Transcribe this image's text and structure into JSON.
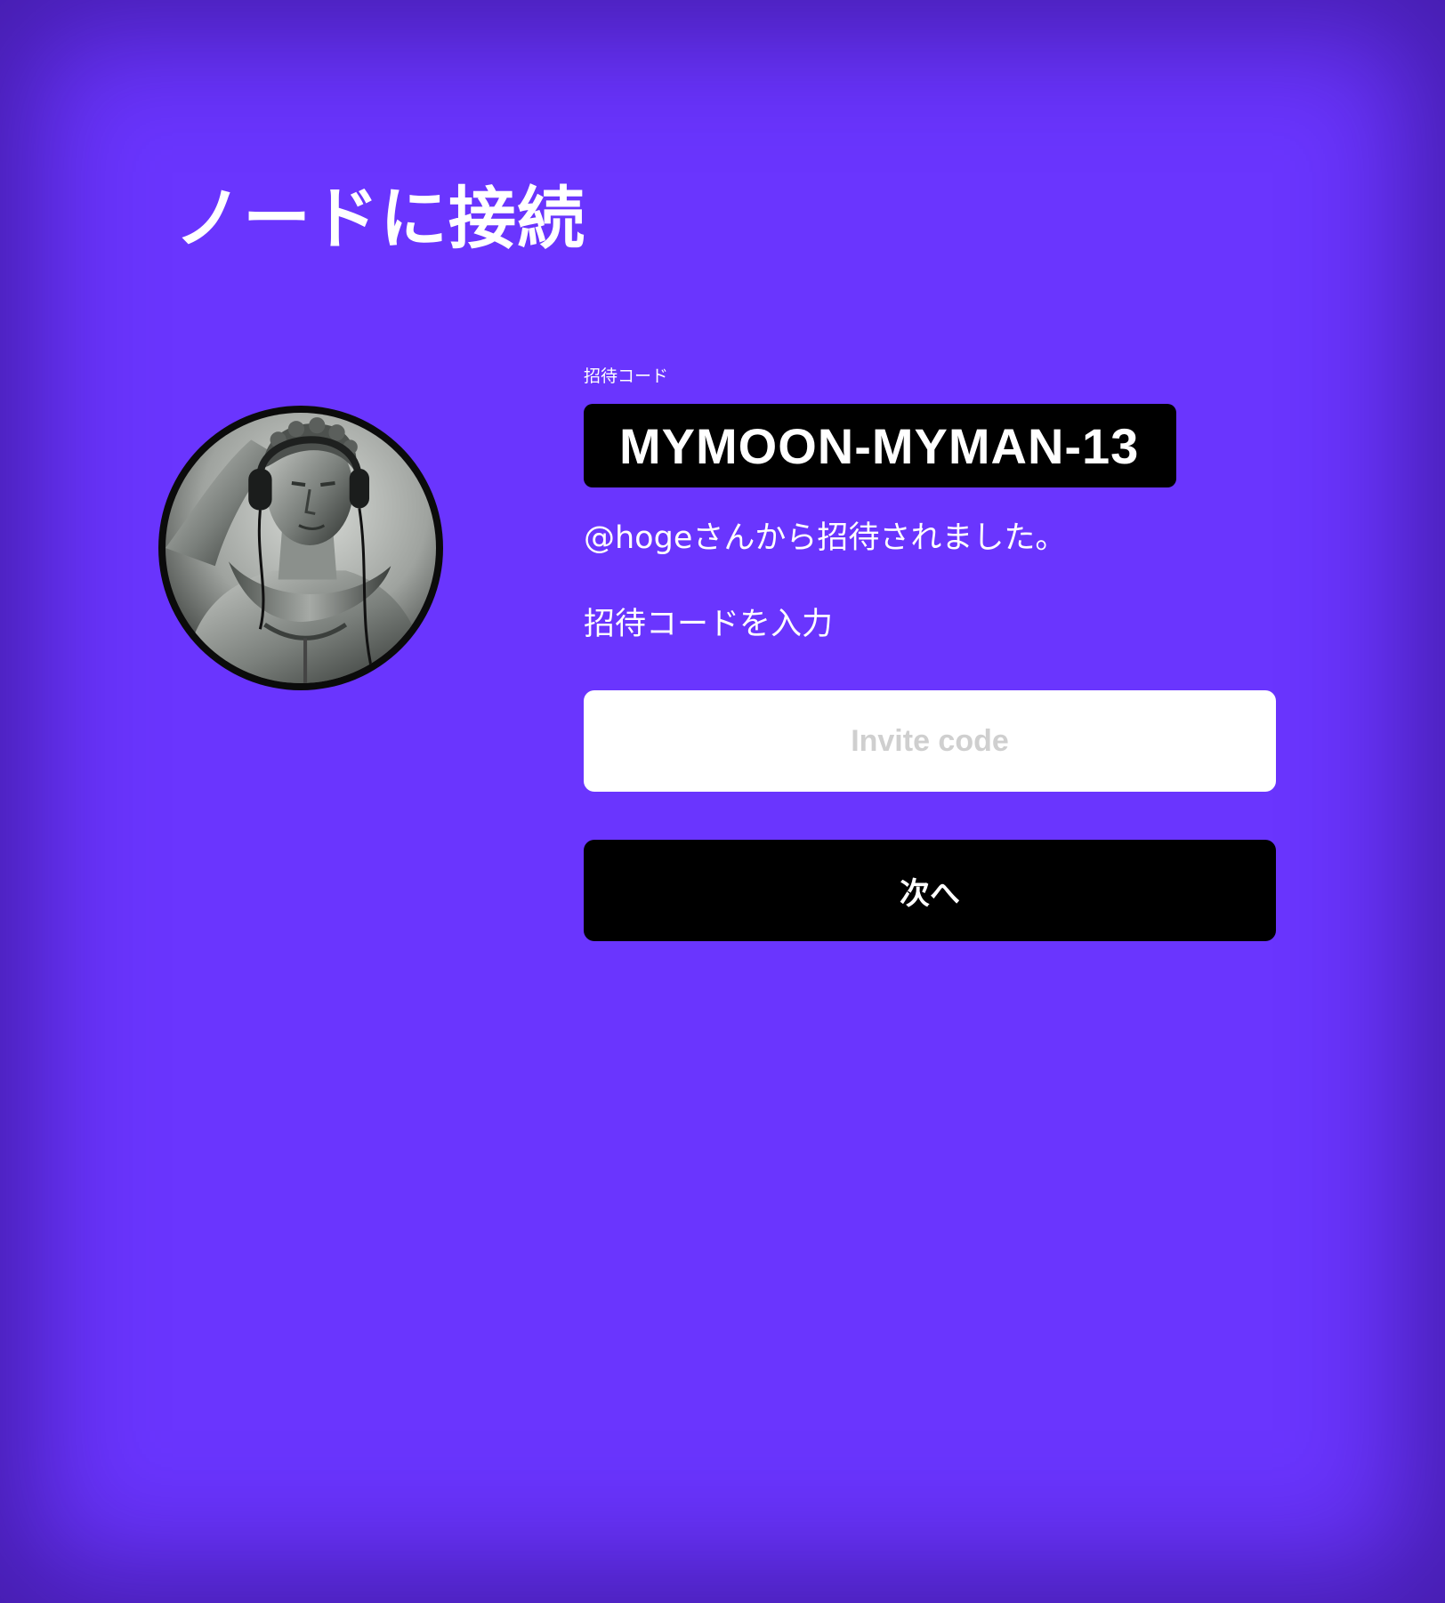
{
  "page": {
    "title": "ノードに接続",
    "background_color": "#6a35fe"
  },
  "inviter": {
    "avatar_icon": "statue-with-headphones-avatar",
    "message": "@hogeさんから招待されました。"
  },
  "invite_code": {
    "caption": "招待コード",
    "value": "MYMOON-MYMAN-13"
  },
  "form": {
    "prompt_label": "招待コードを入力",
    "input_placeholder": "Invite code",
    "input_value": "",
    "next_button_label": "次へ"
  }
}
